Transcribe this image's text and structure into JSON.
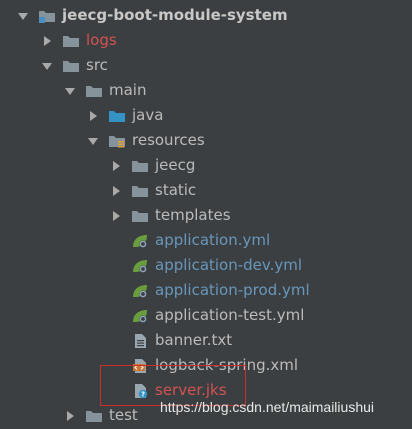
{
  "tree": {
    "items": [
      {
        "label": "jeecg-boot-module-system",
        "expanded": true,
        "icon": "module-folder-icon"
      },
      {
        "label": "logs",
        "expanded": false,
        "icon": "folder-icon"
      },
      {
        "label": "src",
        "expanded": true,
        "icon": "folder-icon"
      },
      {
        "label": "main",
        "expanded": true,
        "icon": "folder-icon"
      },
      {
        "label": "java",
        "expanded": false,
        "icon": "source-folder-icon"
      },
      {
        "label": "resources",
        "expanded": true,
        "icon": "resources-folder-icon"
      },
      {
        "label": "jeecg",
        "expanded": false,
        "icon": "folder-icon"
      },
      {
        "label": "static",
        "expanded": false,
        "icon": "folder-icon"
      },
      {
        "label": "templates",
        "expanded": false,
        "icon": "folder-icon"
      },
      {
        "label": "application.yml",
        "icon": "spring-config-icon"
      },
      {
        "label": "application-dev.yml",
        "icon": "spring-config-icon"
      },
      {
        "label": "application-prod.yml",
        "icon": "spring-config-icon"
      },
      {
        "label": "application-test.yml",
        "icon": "spring-config-icon"
      },
      {
        "label": "banner.txt",
        "icon": "text-file-icon"
      },
      {
        "label": "logback-spring.xml",
        "icon": "xml-file-icon"
      },
      {
        "label": "server.jks",
        "icon": "unknown-file-icon"
      },
      {
        "label": "test",
        "expanded": false,
        "icon": "folder-icon"
      }
    ]
  },
  "colors": {
    "background": "#3c3f41",
    "text_default": "#bbbbbb",
    "text_blue": "#6897bb",
    "text_red": "#d25252",
    "highlight_border": "#c9302c"
  },
  "watermark": "https://blog.csdn.net/maimailiushui"
}
